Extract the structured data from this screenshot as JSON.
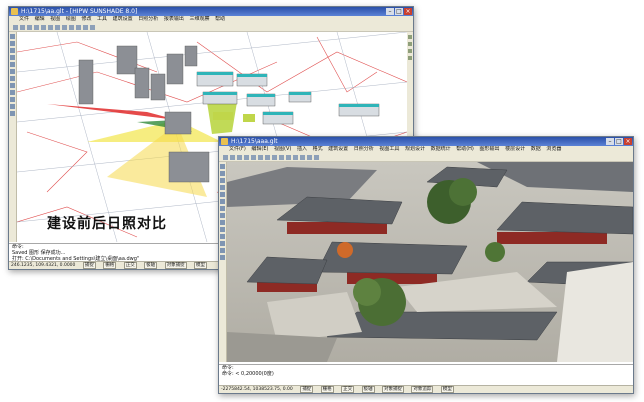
{
  "window_a": {
    "title": "H:\\1715\\aa.glt - [HIPW SUNSHADE 8.0]",
    "menu": [
      "文件",
      "编辑",
      "视图",
      "绘图",
      "修改",
      "工具",
      "建筑设置",
      "日照分析",
      "报表输出",
      "三维观察",
      "帮助"
    ],
    "command_lines": [
      "命令: ",
      "Saved 图形 保存成功...",
      "打开: C:\\Documents and Settings\\建立\\桌面\\aa.dwg\""
    ],
    "status_items": [
      "246.1235, 109.4321, 0.0000",
      "捕捉",
      "栅格",
      "正交",
      "极轴",
      "对象捕捉",
      "模型"
    ]
  },
  "window_b": {
    "title": "H:\\1715\\aaa.glt",
    "menu": [
      "文件(F)",
      "编辑(E)",
      "视图(V)",
      "插入",
      "格式",
      "建筑设置",
      "日照分析",
      "视图工具",
      "规划设计",
      "数据统计",
      "帮助(H)",
      "图形输出",
      "楼层设计",
      "数据",
      "浏览器"
    ],
    "command_lines": [
      "命令: ",
      "命令: < 0,20000(0度)"
    ],
    "status_items": [
      "-2275842.54, 1038523.75, 0.00",
      "捕捉",
      "栅格",
      "正交",
      "极轴",
      "对象捕捉",
      "对象追踪",
      "模型"
    ]
  },
  "caption": "建设前后日照对比"
}
